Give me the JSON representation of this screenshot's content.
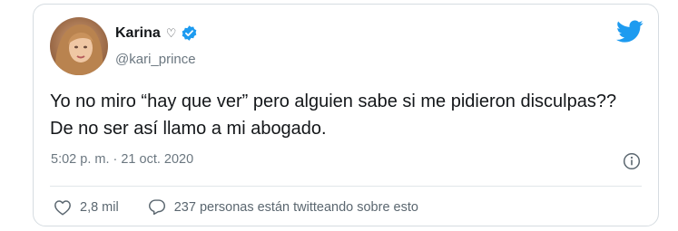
{
  "tweet": {
    "author": {
      "name": "Karina",
      "name_suffix": "♡",
      "handle": "@kari_prince",
      "verified": true
    },
    "text": "Yo no miro “hay que ver” pero alguien sabe si me pidieron disculpas?? De no ser así llamo a mi abogado.",
    "timestamp": "5:02 p. m. · 21 oct. 2020",
    "likes": "2,8 mil",
    "conversation": "237 personas están twitteando sobre esto"
  },
  "icons": {
    "brand": "twitter-bird-icon",
    "verified": "verified-badge-icon",
    "info": "info-icon",
    "like": "heart-icon",
    "reply": "reply-bubble-icon"
  },
  "colors": {
    "brand_blue": "#1d9bf0",
    "text": "#14171a",
    "muted": "#6b7780",
    "border": "#d6dce1"
  }
}
